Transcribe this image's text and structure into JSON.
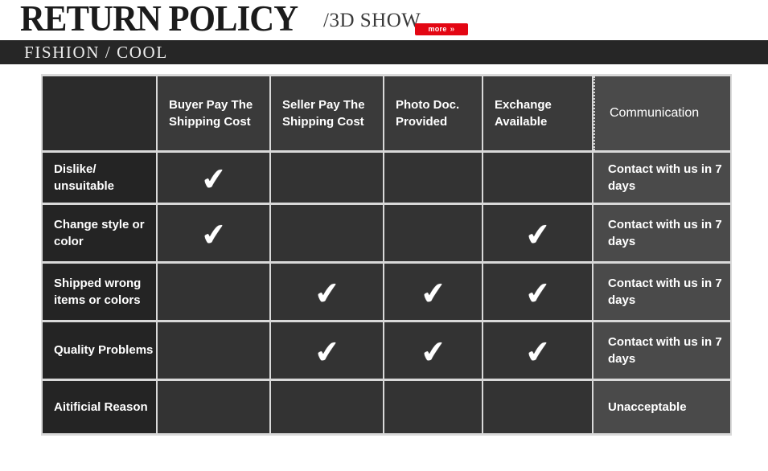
{
  "header": {
    "main_title": "RETURN POLICY",
    "sub_title": "/3D SHOW",
    "more_label": "more",
    "more_chevron": "»",
    "banner_text": "FISHION / COOL"
  },
  "table": {
    "columns": [
      "",
      "Buyer Pay The Shipping Cost",
      "Seller Pay The Shipping Cost",
      "Photo Doc. Provided",
      "Exchange Available",
      "Communication"
    ],
    "check_glyph": "✔",
    "rows": [
      {
        "label": "Dislike/ unsuitable",
        "buyer_pay": "✔",
        "seller_pay": "",
        "photo_doc": "",
        "exchange": "",
        "communication": "Contact with us in 7 days"
      },
      {
        "label": "Change style or color",
        "buyer_pay": "✔",
        "seller_pay": "",
        "photo_doc": "",
        "exchange": "✔",
        "communication": "Contact with us in 7 days"
      },
      {
        "label": "Shipped wrong items or colors",
        "buyer_pay": "",
        "seller_pay": "✔",
        "photo_doc": "✔",
        "exchange": "✔",
        "communication": "Contact with us in 7 days"
      },
      {
        "label": "Quality Problems",
        "buyer_pay": "",
        "seller_pay": "✔",
        "photo_doc": "✔",
        "exchange": "✔",
        "communication": "Contact with us in 7 days"
      },
      {
        "label": "Aitificial Reason",
        "buyer_pay": "",
        "seller_pay": "",
        "photo_doc": "",
        "exchange": "",
        "communication": "Unacceptable"
      }
    ]
  },
  "colors": {
    "accent_red": "#e30613",
    "banner_dark": "#262626",
    "cell_dark": "#2b2b2b",
    "cell_mid": "#333333",
    "cell_light": "#4a4a4a",
    "grid_line": "#d9d9d9"
  }
}
